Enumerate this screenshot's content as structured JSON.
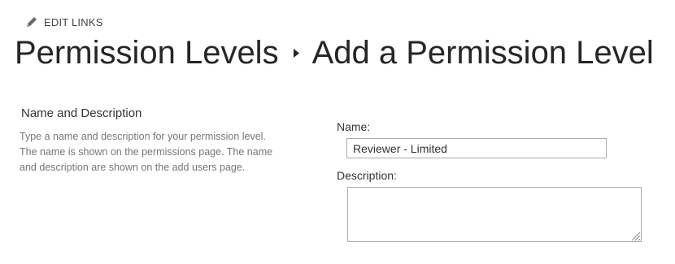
{
  "header": {
    "edit_links_label": "EDIT LINKS",
    "edit_icon": "pencil-icon"
  },
  "breadcrumb": {
    "parent": "Permission Levels",
    "separator_icon": "triangle-right-icon",
    "current": "Add a Permission Level"
  },
  "section": {
    "title": "Name and Description",
    "description_lines": [
      "Type a name and description for your permission level.",
      "The name is shown on the permissions page.  The name",
      "and description are shown on the add users page."
    ]
  },
  "form": {
    "name_label": "Name:",
    "name_value": "Reviewer - Limited",
    "description_label": "Description:",
    "description_value": ""
  }
}
